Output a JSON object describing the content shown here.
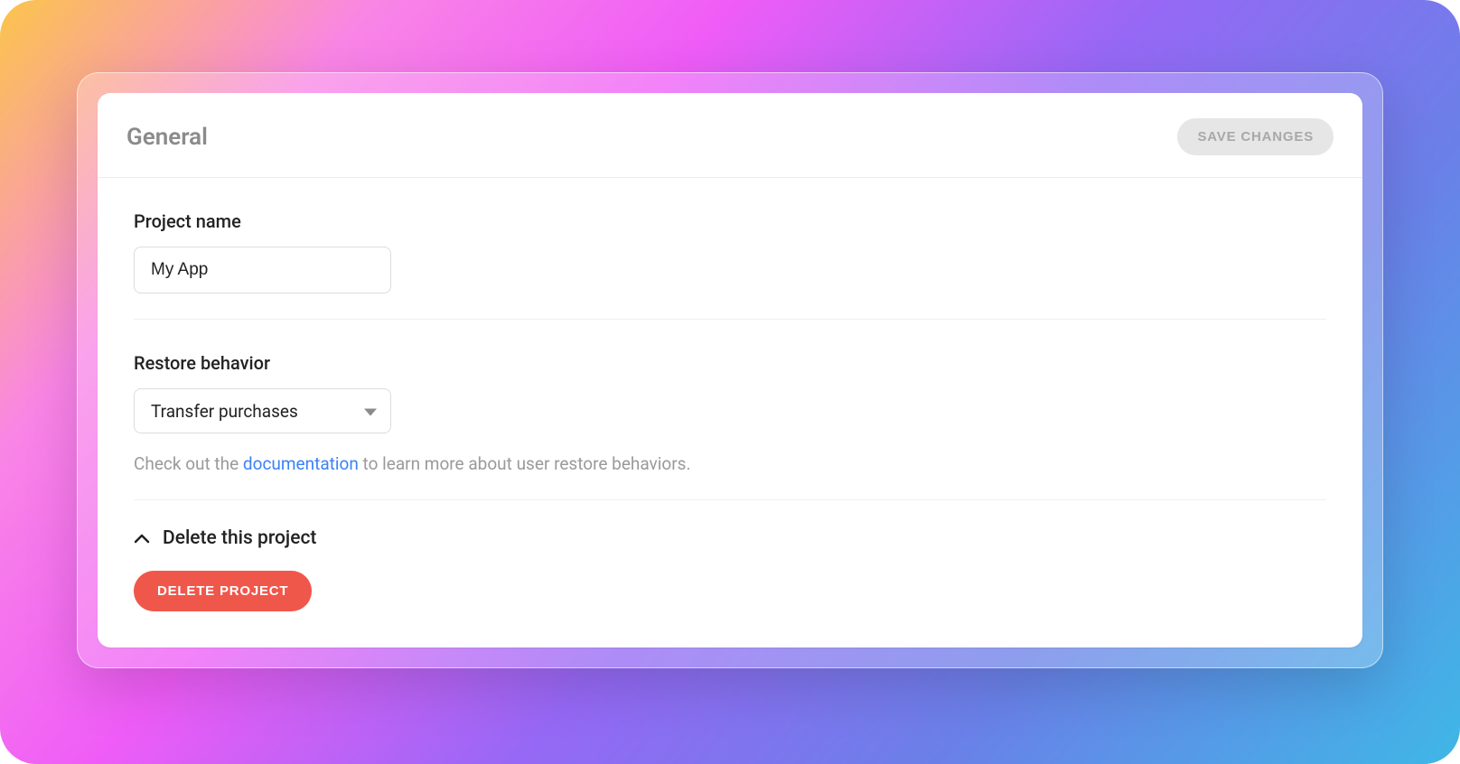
{
  "header": {
    "title": "General",
    "save_label": "SAVE CHANGES"
  },
  "projectName": {
    "label": "Project name",
    "value": "My App"
  },
  "restoreBehavior": {
    "label": "Restore behavior",
    "selected": "Transfer purchases",
    "helper_prefix": "Check out the ",
    "helper_link": "documentation",
    "helper_suffix": " to learn more about user restore behaviors."
  },
  "deleteSection": {
    "title": "Delete this project",
    "button_label": "DELETE PROJECT"
  }
}
